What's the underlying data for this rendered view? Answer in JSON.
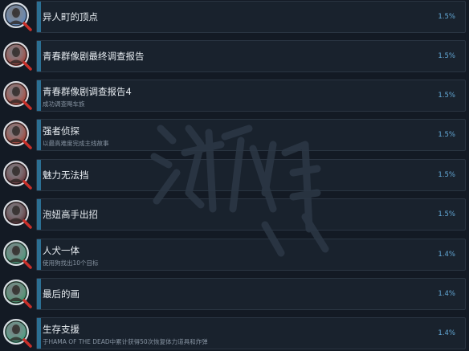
{
  "achievements": [
    {
      "title": "异人町的顶点",
      "desc": "",
      "pct": "1.5%",
      "icon": "portrait-sunglasses-man-icon",
      "color": "#4a79b8"
    },
    {
      "title": "青春群像剧最终调查报告",
      "desc": "",
      "pct": "1.5%",
      "icon": "portrait-woman-icon",
      "color": "#9a2a22"
    },
    {
      "title": "青春群像剧调查报告4",
      "desc": "成功调查飚车族",
      "pct": "1.5%",
      "icon": "portrait-young-man-icon",
      "color": "#a93022"
    },
    {
      "title": "强者侦探",
      "desc": "以最高难度完成主线故事",
      "pct": "1.5%",
      "icon": "scales-of-justice-icon",
      "color": "#a02a1c"
    },
    {
      "title": "魅力无法挡",
      "desc": "",
      "pct": "1.5%",
      "icon": "dark-silhouette-icon",
      "color": "#5a1d22"
    },
    {
      "title": "泡妞高手出招",
      "desc": "",
      "pct": "1.5%",
      "icon": "dark-silhouette-icon",
      "color": "#4d1a20"
    },
    {
      "title": "人犬一体",
      "desc": "使用狗找出10个目标",
      "pct": "1.4%",
      "icon": "dog-icon",
      "color": "#2f8f6a"
    },
    {
      "title": "最后的画",
      "desc": "",
      "pct": "1.4%",
      "icon": "painting-figure-icon",
      "color": "#2e8b5c"
    },
    {
      "title": "生存支援",
      "desc": "于HAMA OF THE DEAD中累计获得50次恢复体力道具和炸弹",
      "pct": "1.4%",
      "icon": "zombie-hand-icon",
      "color": "#2f9a74"
    }
  ],
  "watermark": {
    "text": "游侠网",
    "color": "#2c3846"
  }
}
